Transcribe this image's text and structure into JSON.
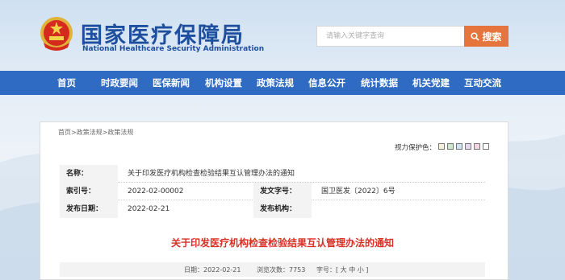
{
  "header": {
    "title_cn": "国家医疗保障局",
    "title_en": "National Healthcare Security Administration",
    "search_placeholder": "请输入关键字查询",
    "search_button": "搜索"
  },
  "nav": {
    "items": [
      {
        "label": "首页"
      },
      {
        "label": "时政要闻"
      },
      {
        "label": "医保新闻"
      },
      {
        "label": "机构设置"
      },
      {
        "label": "政策法规"
      },
      {
        "label": "信息公开"
      },
      {
        "label": "统计数据"
      },
      {
        "label": "机关党建"
      },
      {
        "label": "互动交流"
      }
    ]
  },
  "breadcrumb": "首页>政策法规>政策法规",
  "vision": {
    "label": "视力保护色：",
    "colors": [
      "#f5f3dc",
      "#cfe6d0",
      "#cde3ee",
      "#e5d8ee",
      "#f2d8de",
      "#ffffff"
    ]
  },
  "info": {
    "name_label": "名称：",
    "name_value": "关于印发医疗机构检查检验结果互认管理办法的通知",
    "index_label": "索引号：",
    "index_value": "2022-02-00002",
    "docno_label": "发文字号：",
    "docno_value": "国卫医发〔2022〕6号",
    "date_label": "发布日期：",
    "date_value": "2022-02-21",
    "org_label": "发布机构：",
    "org_value": ""
  },
  "doc_title": "关于印发医疗机构检查检验结果互认管理办法的通知",
  "meta": {
    "date_text": "日期：2022-02-21",
    "views_text": "浏览次数：7753",
    "font_text": "字号：[ 大 中 小 ]"
  },
  "colors": {
    "brand_blue": "#1d4f9e",
    "nav_blue": "#2f6bc2",
    "search_orange": "#e6753d",
    "title_red": "#d93025"
  }
}
